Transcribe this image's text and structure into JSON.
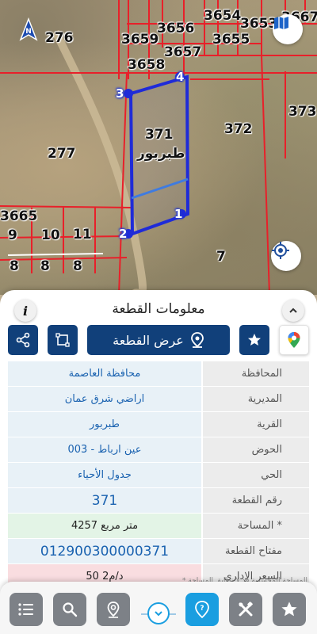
{
  "map": {
    "parcel_numbers": [
      "276",
      "3656",
      "3659",
      "3654",
      "3653",
      "3657",
      "3655",
      "3667",
      "3658",
      "372",
      "373",
      "277",
      "3665",
      "9",
      "10",
      "11",
      "8",
      "8",
      "8",
      "7"
    ],
    "selected_parcel": {
      "number": "371",
      "village": "طبربور"
    },
    "vertices": [
      "1",
      "2",
      "3",
      "4"
    ]
  },
  "panel": {
    "title": "معلومات القطعة",
    "show_parcel_label": "عرض القطعة"
  },
  "details": [
    {
      "key": "المحافظة",
      "value": "محافظة العاصمة"
    },
    {
      "key": "المديرية",
      "value": "اراضي شرق عمان"
    },
    {
      "key": "القرية",
      "value": "طبربور"
    },
    {
      "key": "الحوض",
      "value": "عين ارباط - 003"
    },
    {
      "key": "الحي",
      "value": "جدول الأحياء"
    },
    {
      "key": "رقم القطعة",
      "value": "371"
    },
    {
      "key": "المساحة *",
      "value": "4257 متر مربع"
    },
    {
      "key": "مفتاح القطعة",
      "value": "012900300000371"
    },
    {
      "key": "السعر الإداري",
      "value": "50 د/م2"
    }
  ],
  "footnote": "* المساحة المحسوبة قد لا تطابق المساحة",
  "colors": {
    "primary": "#11407a",
    "accent": "#1a9ee0",
    "boundary": "#1f2bd8",
    "parcel_lines": "#e8202a"
  }
}
